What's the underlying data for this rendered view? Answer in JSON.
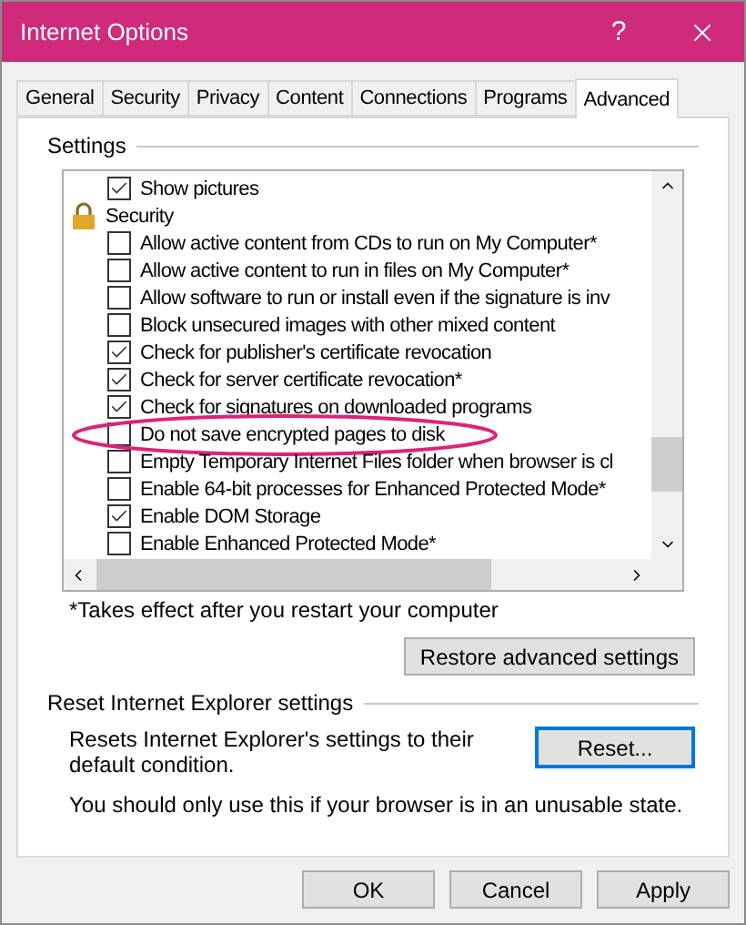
{
  "window": {
    "title": "Internet Options",
    "help_button": "?"
  },
  "tabs": [
    {
      "label": "General",
      "selected": false
    },
    {
      "label": "Security",
      "selected": false
    },
    {
      "label": "Privacy",
      "selected": false
    },
    {
      "label": "Content",
      "selected": false
    },
    {
      "label": "Connections",
      "selected": false
    },
    {
      "label": "Programs",
      "selected": false
    },
    {
      "label": "Advanced",
      "selected": true
    }
  ],
  "settings": {
    "title": "Settings",
    "items": [
      {
        "kind": "checkbox",
        "label": "Show pictures",
        "checked": true,
        "highlighted": false
      },
      {
        "kind": "category",
        "label": "Security"
      },
      {
        "kind": "checkbox",
        "label": "Allow active content from CDs to run on My Computer*",
        "checked": false,
        "highlighted": false
      },
      {
        "kind": "checkbox",
        "label": "Allow active content to run in files on My Computer*",
        "checked": false,
        "highlighted": false
      },
      {
        "kind": "checkbox",
        "label": "Allow software to run or install even if the signature is inv",
        "checked": false,
        "highlighted": false
      },
      {
        "kind": "checkbox",
        "label": "Block unsecured images with other mixed content",
        "checked": false,
        "highlighted": false
      },
      {
        "kind": "checkbox",
        "label": "Check for publisher's certificate revocation",
        "checked": true,
        "highlighted": false
      },
      {
        "kind": "checkbox",
        "label": "Check for server certificate revocation*",
        "checked": true,
        "highlighted": false
      },
      {
        "kind": "checkbox",
        "label": "Check for signatures on downloaded programs",
        "checked": true,
        "highlighted": false
      },
      {
        "kind": "checkbox",
        "label": "Do not save encrypted pages to disk",
        "checked": false,
        "highlighted": true
      },
      {
        "kind": "checkbox",
        "label": "Empty Temporary Internet Files folder when browser is cl",
        "checked": false,
        "highlighted": false
      },
      {
        "kind": "checkbox",
        "label": "Enable 64-bit processes for Enhanced Protected Mode*",
        "checked": false,
        "highlighted": false
      },
      {
        "kind": "checkbox",
        "label": "Enable DOM Storage",
        "checked": true,
        "highlighted": false
      },
      {
        "kind": "checkbox",
        "label": "Enable Enhanced Protected Mode*",
        "checked": false,
        "highlighted": false
      }
    ],
    "note": "*Takes effect after you restart your computer",
    "restore_button": "Restore advanced settings"
  },
  "reset": {
    "title": "Reset Internet Explorer settings",
    "description": "Resets Internet Explorer's settings to their default condition.",
    "button": "Reset...",
    "warning": "You should only use this if your browser is in an unusable state."
  },
  "buttons": [
    "OK",
    "Cancel",
    "Apply"
  ]
}
